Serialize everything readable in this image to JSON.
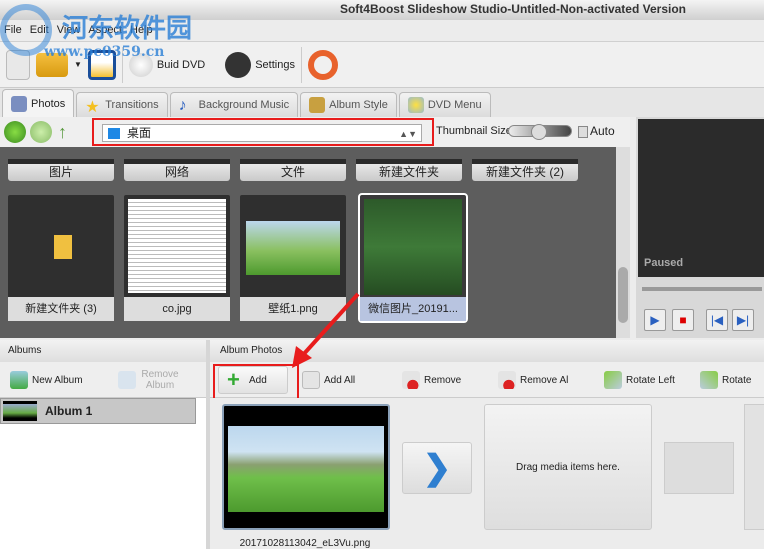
{
  "window": {
    "title": "Soft4Boost Slideshow Studio-Untitled-Non-activated Version"
  },
  "menu": [
    "File",
    "Edit",
    "View",
    "Aspect",
    "Help"
  ],
  "toolbar": {
    "build_dvd": "Buid DVD",
    "settings": "Settings"
  },
  "tabs": [
    "Photos",
    "Transitions",
    "Background Music",
    "Album Style",
    "DVD Menu"
  ],
  "nav": {
    "path": "桌面",
    "thumbnail_size": "Thumbnail Size:",
    "auto": "Auto"
  },
  "folders": [
    "图片",
    "网络",
    "文件",
    "新建文件夹",
    "新建文件夹 (2)"
  ],
  "files": [
    "新建文件夹 (3)",
    "co.jpg",
    "壁纸1.png",
    "微信图片_20191..."
  ],
  "preview": {
    "status": "Paused"
  },
  "albums": {
    "header": "Albums",
    "new_album": "New Album",
    "remove_album": "Remove Album",
    "items": [
      "Album 1"
    ]
  },
  "album_photos": {
    "header": "Album Photos",
    "add": "Add",
    "add_all": "Add All",
    "remove": "Remove",
    "remove_all": "Remove Al",
    "rotate_left": "Rotate Left",
    "rotate_right": "Rotate",
    "photo_name": "20171028113042_eL3Vu.png",
    "drop_hint": "Drag media items here."
  },
  "watermark": {
    "name": "河东软件园",
    "url": "www.pc0359.cn"
  }
}
